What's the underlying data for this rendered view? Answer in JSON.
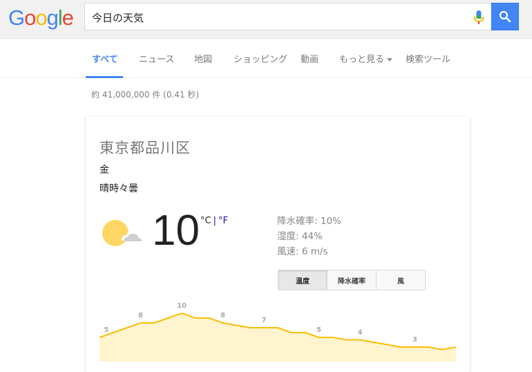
{
  "logo": {
    "letters": [
      "G",
      "o",
      "o",
      "g",
      "l",
      "e"
    ],
    "colors": [
      "#4285f4",
      "#ea4335",
      "#fbbc05",
      "#4285f4",
      "#34a853",
      "#ea4335"
    ]
  },
  "search": {
    "query": "今日の天気"
  },
  "tabs": [
    {
      "label": "すべて",
      "active": true
    },
    {
      "label": "ニュース",
      "active": false
    },
    {
      "label": "地図",
      "active": false
    },
    {
      "label": "ショッピング",
      "active": false
    },
    {
      "label": "動画",
      "active": false
    },
    {
      "label": "もっと見る",
      "active": false,
      "dropdown": true
    },
    {
      "label": "検索ツール",
      "active": false
    }
  ],
  "result_stats": "約 41,000,000 件 (0.41 秒)",
  "weather": {
    "location": "東京都品川区",
    "day": "金",
    "condition": "晴時々曇",
    "temperature": "10",
    "unit_c": "°C",
    "unit_sep": "|",
    "unit_f": "°F",
    "precip_label": "降水確率:",
    "precip_value": "10%",
    "humidity_label": "湿度:",
    "humidity_value": "44%",
    "wind_label": "風速:",
    "wind_value": "6 m/s",
    "toggle": [
      {
        "label": "温度",
        "active": true
      },
      {
        "label": "降水確率",
        "active": false
      },
      {
        "label": "風",
        "active": false
      }
    ]
  },
  "chart_data": {
    "type": "area",
    "y": [
      5,
      6,
      7,
      8,
      8,
      9,
      10,
      9,
      9,
      8,
      7.5,
      7,
      7,
      7,
      6,
      6,
      5,
      5,
      4.5,
      4.5,
      4,
      3.5,
      3,
      3,
      3,
      2.5,
      3
    ],
    "labels": [
      {
        "index": 0,
        "text": "5"
      },
      {
        "index": 3,
        "text": "8"
      },
      {
        "index": 6,
        "text": "10"
      },
      {
        "index": 9,
        "text": "8"
      },
      {
        "index": 12,
        "text": "7"
      },
      {
        "index": 16,
        "text": "5"
      },
      {
        "index": 19,
        "text": "4"
      },
      {
        "index": 23,
        "text": "3"
      }
    ],
    "line_color": "#fbbc05",
    "fill_color": "#fff4ce",
    "label_color": "#aaaaaa"
  }
}
